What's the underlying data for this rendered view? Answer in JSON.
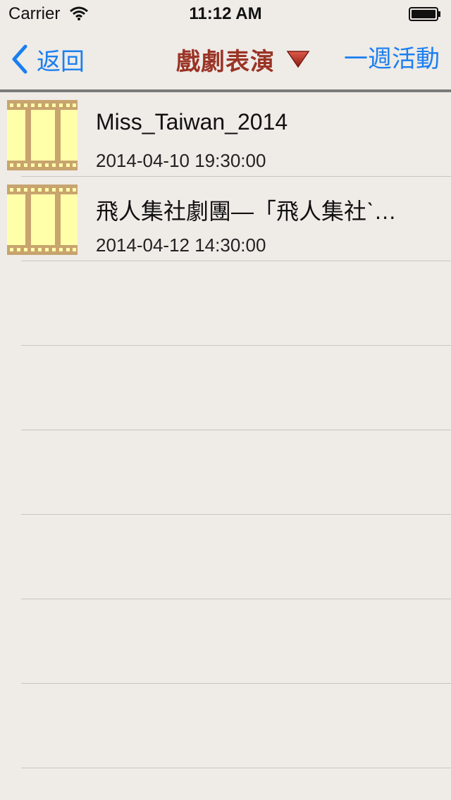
{
  "status_bar": {
    "carrier": "Carrier",
    "time": "11:12 AM",
    "wifi_icon": "wifi-icon",
    "battery_icon": "battery-icon"
  },
  "nav": {
    "back_label": "返回",
    "back_icon": "chevron-left-icon",
    "title": "戲劇表演",
    "dropdown_icon": "triangle-down-icon",
    "right_label": "一週活動"
  },
  "colors": {
    "background": "#efebe7",
    "link_blue": "#1a7ff0",
    "title_red": "#9a3426",
    "film_yellow": "#ffffaa",
    "film_tan": "#c8a46e"
  },
  "list": {
    "rows": [
      {
        "title": "Miss_Taiwan_2014",
        "date": "2014-04-10 19:30:00",
        "icon": "film-strip-icon"
      },
      {
        "title": "飛人集社劇團—「飛人集社ˋ…",
        "date": "2014-04-12 14:30:00",
        "icon": "film-strip-icon"
      }
    ],
    "empty_row_count": 6
  }
}
